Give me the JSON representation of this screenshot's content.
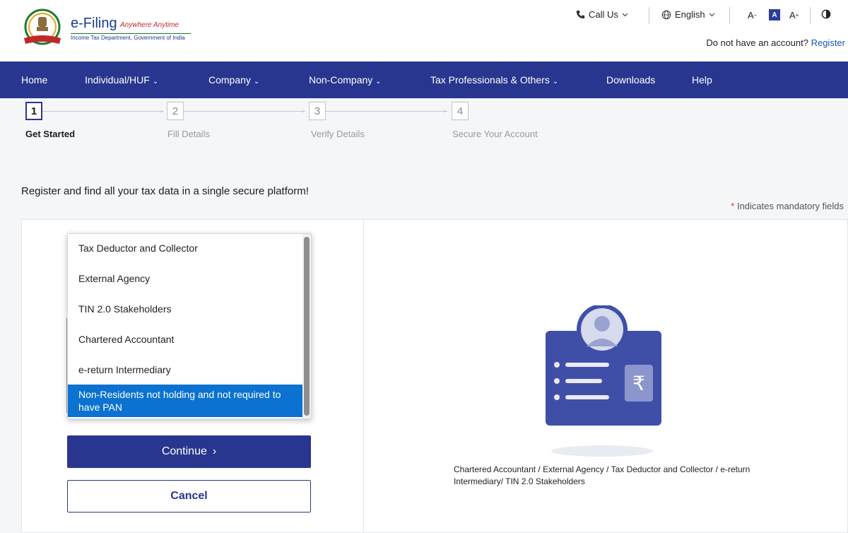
{
  "header": {
    "logo_title": "e-Filing",
    "logo_tagline": "Anywhere Anytime",
    "logo_subtitle": "Income Tax Department, Government of India",
    "call_us": "Call Us",
    "language": "English",
    "font_decrease": "A",
    "font_default": "A",
    "font_increase": "A",
    "account_prompt": "Do not have an account?",
    "register_link": "Register"
  },
  "nav": {
    "items": [
      {
        "label": "Home"
      },
      {
        "label": "Individual/HUF"
      },
      {
        "label": "Company"
      },
      {
        "label": "Non-Company"
      },
      {
        "label": "Tax Professionals & Others"
      },
      {
        "label": "Downloads"
      },
      {
        "label": "Help"
      }
    ]
  },
  "stepper": {
    "steps": [
      {
        "number": "1",
        "label": "Get Started",
        "active": true
      },
      {
        "number": "2",
        "label": "Fill Details",
        "active": false
      },
      {
        "number": "3",
        "label": "Verify Details",
        "active": false
      },
      {
        "number": "4",
        "label": "Secure Your Account",
        "active": false
      }
    ]
  },
  "main": {
    "intro": "Register and find all your tax data in a single secure platform!",
    "mandatory_star": "*",
    "mandatory_note": "Indicates mandatory fields",
    "dropdown": {
      "options": [
        {
          "label": "Tax Deductor and Collector"
        },
        {
          "label": "External Agency"
        },
        {
          "label": "TIN 2.0 Stakeholders"
        },
        {
          "label": "Chartered Accountant"
        },
        {
          "label": "e-return Intermediary"
        },
        {
          "label": "Non-Residents not holding and not required to have PAN",
          "selected": true
        }
      ]
    },
    "continue_button": "Continue",
    "cancel_button": "Cancel",
    "illustration_caption": "Chartered Accountant / External Agency / Tax Deductor and Collector / e-return Intermediary/ TIN 2.0 Stakeholders"
  },
  "colors": {
    "nav_bg": "#29368f",
    "selected_option": "#0b72d1",
    "link": "#1a56b8",
    "required_star": "#d0312d"
  }
}
